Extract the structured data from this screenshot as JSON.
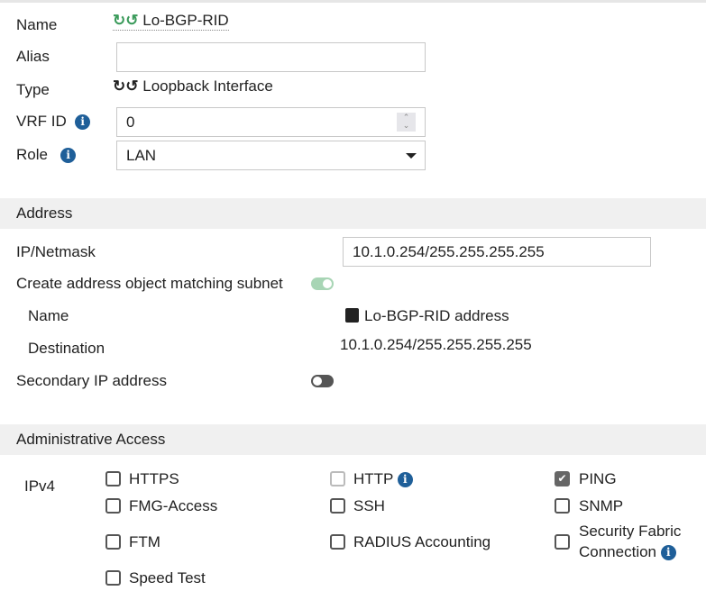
{
  "general": {
    "name_label": "Name",
    "name_value": "Lo-BGP-RID",
    "alias_label": "Alias",
    "alias_value": "",
    "type_label": "Type",
    "type_value": "Loopback Interface",
    "vrf_label": "VRF ID",
    "vrf_value": "0",
    "role_label": "Role",
    "role_value": "LAN"
  },
  "address": {
    "section_title": "Address",
    "ip_label": "IP/Netmask",
    "ip_value": "10.1.0.254/255.255.255.255",
    "create_label": "Create address object matching subnet",
    "create_enabled": true,
    "obj_name_label": "Name",
    "obj_name_value": "Lo-BGP-RID address",
    "dest_label": "Destination",
    "dest_value": "10.1.0.254/255.255.255.255",
    "secondary_label": "Secondary IP address",
    "secondary_enabled": false
  },
  "admin": {
    "section_title": "Administrative Access",
    "ipv4_label": "IPv4",
    "options": [
      {
        "label": "HTTPS",
        "checked": false
      },
      {
        "label": "HTTP",
        "checked": false,
        "disabled": true
      },
      {
        "label": "PING",
        "checked": true
      },
      {
        "label": "FMG-Access",
        "checked": false
      },
      {
        "label": "SSH",
        "checked": false
      },
      {
        "label": "SNMP",
        "checked": false
      },
      {
        "label": "FTM",
        "checked": false
      },
      {
        "label": "RADIUS Accounting",
        "checked": false
      },
      {
        "label": "Security Fabric",
        "label2": "Connection",
        "checked": false
      },
      {
        "label": "Speed Test",
        "checked": false
      }
    ]
  },
  "colors": {
    "accent_green": "#a8d5b5",
    "info_blue": "#1f5f99",
    "section_bg": "#f0f0f0"
  }
}
